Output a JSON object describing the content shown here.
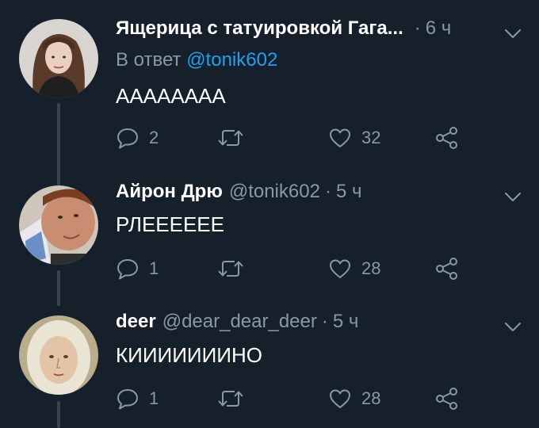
{
  "tweets": [
    {
      "display_name": "Ящерица с татуировкой Гага...",
      "handle": "",
      "separator": "·",
      "time": "6 ч",
      "reply_prefix": "В ответ",
      "reply_to": "@tonik602",
      "text": "АААААААА",
      "reply_count": "2",
      "retweet_count": "",
      "like_count": "32"
    },
    {
      "display_name": "Айрон Дрю",
      "handle": "@tonik602",
      "separator": "·",
      "time": "5 ч",
      "text": "РЛЕЕЕЕЕЕ",
      "reply_count": "1",
      "retweet_count": "",
      "like_count": "28"
    },
    {
      "display_name": "deer",
      "handle": "@dear_dear_deer",
      "separator": "·",
      "time": "5 ч",
      "text": "КИИИИИИИНО",
      "reply_count": "1",
      "retweet_count": "",
      "like_count": "28"
    }
  ],
  "icons": {
    "reply": "speech-bubble-icon",
    "retweet": "retweet-arrows-icon",
    "like": "heart-icon",
    "share": "share-nodes-icon",
    "menu": "chevron-down-icon"
  },
  "colors": {
    "background": "#15202b",
    "secondary_text": "#8899a6",
    "link": "#1da1f2",
    "thread_line": "#38444d"
  }
}
